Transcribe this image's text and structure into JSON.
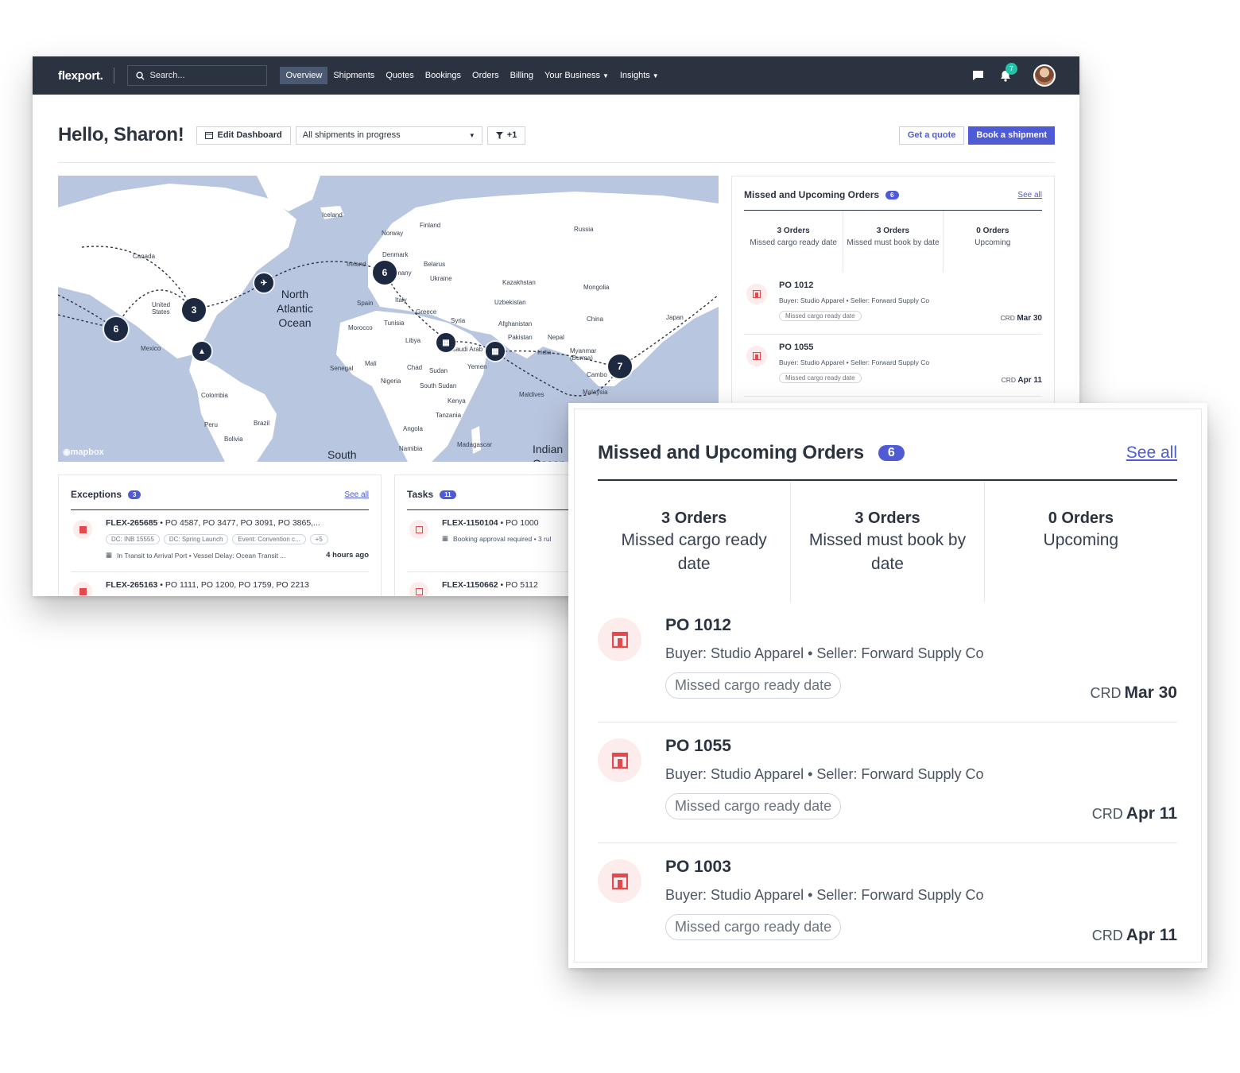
{
  "app": {
    "logo": "flexport.",
    "search_placeholder": "Search...",
    "nav": [
      {
        "label": "Overview",
        "active": true
      },
      {
        "label": "Shipments"
      },
      {
        "label": "Quotes"
      },
      {
        "label": "Bookings"
      },
      {
        "label": "Orders"
      },
      {
        "label": "Billing"
      },
      {
        "label": "Your Business",
        "dropdown": true
      },
      {
        "label": "Insights",
        "dropdown": true
      }
    ],
    "notification_count": "7",
    "icons": {
      "messages": "chat-icon",
      "notifications": "bell-icon",
      "search": "search-icon"
    }
  },
  "header": {
    "greeting": "Hello, Sharon!",
    "edit_dashboard": "Edit Dashboard",
    "shipment_filter": "All shipments in progress",
    "filter_count": "+1",
    "get_quote": "Get a quote",
    "book_shipment": "Book a shipment"
  },
  "map": {
    "attribution": "mapbox",
    "labels": {
      "iceland": "Iceland",
      "finland": "Finland",
      "norway": "Norway",
      "russia": "Russia",
      "canada": "Canada",
      "denmark": "Denmark",
      "ireland": "Ireland",
      "belarus": "Belarus",
      "germany": "many",
      "ukraine": "Ukraine",
      "kazakhstan": "Kazakhstan",
      "mongolia": "Mongolia",
      "north_atlantic": "North\nAtlantic\nOcean",
      "united_states": "United\nStates",
      "spain": "Spain",
      "italy": "Italy",
      "uzbekistan": "Uzbekistan",
      "greece": "Greece",
      "japan": "Japan",
      "morocco": "Morocco",
      "tunisia": "Tunisia",
      "syria": "Syria",
      "afghanistan": "Afghanistan",
      "china": "China",
      "mexico": "Mexico",
      "libya": "Libya",
      "pakistan": "Pakistan",
      "nepal": "Nepal",
      "saudi": "Saudi Arab",
      "india": "India",
      "myanmar": "Myanmar\n(Burma)",
      "senegal": "Senegal",
      "mali": "Mali",
      "chad": "Chad",
      "sudan": "Sudan",
      "yemen": "Yemen",
      "cambodia": "Cambo",
      "nigeria": "Nigeria",
      "south_sudan": "South Sudan",
      "maldives": "Maldives",
      "malaysia": "Malaysia",
      "colombia": "Colombia",
      "kenya": "Kenya",
      "brazil": "Brazil",
      "peru": "Peru",
      "tanzania": "Tanzania",
      "bolivia": "Bolivia",
      "angola": "Angola",
      "namibia": "Namibia",
      "madagascar": "Madagascar",
      "south": "South",
      "indian": "Indian\nOcean"
    },
    "clusters": [
      {
        "id": "us-west",
        "count": "6",
        "flag_count": "1"
      },
      {
        "id": "us-east",
        "count": "3"
      },
      {
        "id": "europe",
        "count": "6",
        "flag_count": "2"
      },
      {
        "id": "asia",
        "count": "7"
      }
    ]
  },
  "orders_small": {
    "title": "Missed and Upcoming Orders",
    "count": "6",
    "see_all": "See all",
    "stats": [
      {
        "number": "3 Orders",
        "label": "Missed cargo ready date"
      },
      {
        "number": "3 Orders",
        "label": "Missed must book by date"
      },
      {
        "number": "0 Orders",
        "label": "Upcoming"
      }
    ],
    "items": [
      {
        "po": "PO 1012",
        "parties": "Buyer: Studio Apparel • Seller: Forward Supply Co",
        "tag": "Missed cargo ready date",
        "crd_label": "CRD",
        "crd_date": "Mar 30"
      },
      {
        "po": "PO 1055",
        "parties": "Buyer: Studio Apparel • Seller: Forward Supply Co",
        "tag": "Missed cargo ready date",
        "crd_label": "CRD",
        "crd_date": "Apr 11"
      }
    ]
  },
  "exceptions": {
    "title": "Exceptions",
    "count": "3",
    "see_all": "See all",
    "rows": [
      {
        "id": "FLEX-265685",
        "pos": " • PO 4587, PO 3477, PO 3091, PO 3865,...",
        "chips": [
          "DC: INB 15555",
          "DC: Spring Launch",
          "Event: Convention c...",
          "+5"
        ],
        "status": "In Transit to Arrival Port • Vessel Delay: Ocean Transit ...",
        "time": "4 hours ago"
      },
      {
        "id": "FLEX-265163",
        "pos": " • PO 1111, PO 1200, PO 1759, PO 2213"
      }
    ]
  },
  "tasks": {
    "title": "Tasks",
    "count": "11",
    "rows": [
      {
        "id": "FLEX-1150104",
        "pos": " • PO 1000",
        "status": "Booking approval required • 3 rul"
      },
      {
        "id": "FLEX-1150662",
        "pos": " • PO 5112"
      }
    ]
  },
  "orders_zoom": {
    "title": "Missed and Upcoming Orders",
    "count": "6",
    "see_all": "See all",
    "stats": [
      {
        "number": "3 Orders",
        "label": "Missed cargo ready date"
      },
      {
        "number": "3 Orders",
        "label": "Missed must book by date"
      },
      {
        "number": "0 Orders",
        "label": "Upcoming"
      }
    ],
    "items": [
      {
        "po": "PO 1012",
        "parties": "Buyer: Studio Apparel • Seller: Forward Supply Co",
        "tag": "Missed cargo ready date",
        "crd_label": "CRD",
        "crd_date": "Mar 30"
      },
      {
        "po": "PO 1055",
        "parties": "Buyer: Studio Apparel • Seller: Forward Supply Co",
        "tag": "Missed cargo ready date",
        "crd_label": "CRD",
        "crd_date": "Apr 11"
      },
      {
        "po": "PO 1003",
        "parties": "Buyer: Studio Apparel • Seller: Forward Supply Co",
        "tag": "Missed cargo ready date",
        "crd_label": "CRD",
        "crd_date": "Apr 11"
      }
    ]
  },
  "colors": {
    "accent": "#4f5bd5",
    "nav_bg": "#2c3340",
    "danger": "#e5484d",
    "map_water": "#b9c6df",
    "map_land": "#ffffff",
    "teal": "#22c3a7"
  }
}
